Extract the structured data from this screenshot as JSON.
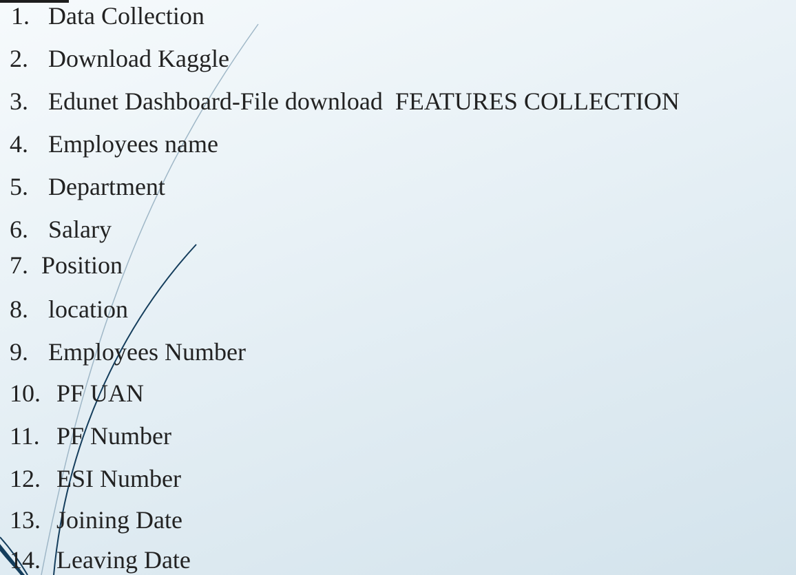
{
  "list": {
    "items": [
      {
        "num": "1.",
        "text": "Data Collection"
      },
      {
        "num": "2.",
        "text": "Download Kaggle"
      },
      {
        "num": "3.",
        "text": "Edunet Dashboard-File download  FEATURES COLLECTION"
      },
      {
        "num": "4.",
        "text": "Employees name"
      },
      {
        "num": "5.",
        "text": "Department"
      },
      {
        "num": "6.",
        "text": "Salary"
      },
      {
        "num": "7.",
        "text": "Position"
      },
      {
        "num": "8.",
        "text": "location"
      },
      {
        "num": "9.",
        "text": "Employees Number"
      },
      {
        "num": "10.",
        "text": "PF UAN"
      },
      {
        "num": "11.",
        "text": "PF Number"
      },
      {
        "num": "12.",
        "text": "ESI Number"
      },
      {
        "num": "13.",
        "text": "Joining Date"
      },
      {
        "num": "14.",
        "text": "Leaving Date"
      }
    ]
  },
  "colors": {
    "background_light": "#f6fafc",
    "background_dark": "#d3e3ec",
    "swoosh_dark": "#143d5c",
    "swoosh_light": "#9fb7c7",
    "text": "#222222"
  }
}
